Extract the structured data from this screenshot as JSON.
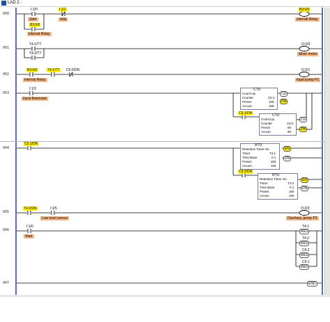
{
  "window": {
    "title": "LAD 2 -"
  },
  "rung_numbers": [
    "000",
    "001",
    "002",
    "003",
    "004",
    "005",
    "006",
    "007"
  ],
  "rung0": {
    "c1_addr": "I:1/0",
    "c1_desc": "Start",
    "c2_addr": "I:1/1",
    "c2_desc": "stop",
    "b_addr": "B3:0/0",
    "b_desc": "internal Relay",
    "out_addr": "B3:0/0",
    "out_desc": "internal Relay"
  },
  "rung1": {
    "c1_addr": "T4:1/TT",
    "c2_addr": "T4:2/TT",
    "out_addr": "O:2/0",
    "out_desc": "Mixer motor"
  },
  "rung2": {
    "c1_addr": "B3:0/0",
    "c1_desc": "internal Relay",
    "c2_addr": "T4:1/TT",
    "c3_addr": "C5:2/DN",
    "out_addr": "O:2/1",
    "out_desc": "input pump P1"
  },
  "rung3": {
    "c1_addr": "I:1/3",
    "c1_desc": "Input flowmeter",
    "c2_addr": "C5:1/DN",
    "ctu1": {
      "title": "CTU",
      "name": "Count Up",
      "counter_label": "Counter",
      "counter": "C5:1",
      "preset_label": "Preset",
      "preset": "100",
      "accum_label": "Accum",
      "accum": "159",
      "cu": "CU",
      "dn": "DN"
    },
    "ctu2": {
      "title": "CTU",
      "name": "Count Up",
      "counter_label": "Counter",
      "counter": "C5:2",
      "preset_label": "Preset",
      "preset": "60",
      "accum_label": "Accum",
      "accum": "80",
      "cu": "CU",
      "dn": "DN"
    }
  },
  "rung4": {
    "c1_addr": "C5:1/DN",
    "c2_addr": "C5:2/DN",
    "rto1": {
      "title": "RTO",
      "name": "Retentive Timer On",
      "timer_label": "Timer",
      "timer": "T4:1",
      "tb_label": "Time Base",
      "tb": "0.1",
      "preset_label": "Preset",
      "preset": "300",
      "accum_label": "Accum",
      "accum": "100",
      "en": "EN",
      "dn": "DN"
    },
    "rto2": {
      "title": "RTO",
      "name": "Retentive Timer On",
      "timer_label": "Timer",
      "timer": "T4:2",
      "tb_label": "Time Base",
      "tb": "0.1",
      "preset_label": "Preset",
      "preset": "200",
      "accum_label": "Accum",
      "accum": "100",
      "en": "EN",
      "dn": "DN"
    }
  },
  "rung5": {
    "c1_addr": "T4:2/DN",
    "c2_addr": "I:1/5",
    "c2_desc": "Low level sensor",
    "out_addr": "O:2/3",
    "out_desc": "Discharg. pump P3"
  },
  "rung6": {
    "c1_addr": "I:1/0",
    "c1_desc": "Start",
    "res": [
      {
        "addr": "T4:1",
        "label": "RES"
      },
      {
        "addr": "T4:2",
        "label": "RES"
      },
      {
        "addr": "C5:2",
        "label": "RES"
      },
      {
        "addr": "C5:1",
        "label": "RES"
      }
    ]
  },
  "rung7": {
    "end": "END"
  },
  "colors": {
    "rail": "#5a6fb5",
    "active": "#fff200",
    "description": "#f5b98a",
    "wire": "#000000"
  },
  "icons": [
    "window-icon",
    "no-contact-icon",
    "nc-contact-icon",
    "output-coil-icon",
    "reset-coil-icon"
  ]
}
